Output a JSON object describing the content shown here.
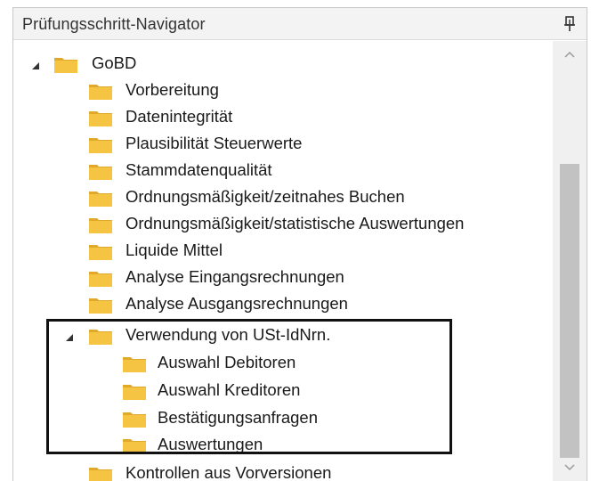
{
  "panel": {
    "title": "Prüfungsschritt-Navigator",
    "pin_icon": "pin-icon"
  },
  "tree": {
    "root": {
      "label": "GoBD",
      "expanded": true
    },
    "items": [
      {
        "label": "Vorbereitung"
      },
      {
        "label": "Datenintegrität"
      },
      {
        "label": "Plausibilität Steuerwerte"
      },
      {
        "label": "Stammdatenqualität"
      },
      {
        "label": "Ordnungsmäßigkeit/zeitnahes Buchen"
      },
      {
        "label": "Ordnungsmäßigkeit/statistische Auswertungen"
      },
      {
        "label": "Liquide Mittel"
      },
      {
        "label": "Analyse Eingangsrechnungen"
      },
      {
        "label": "Analyse Ausgangsrechnungen"
      },
      {
        "label": "Verwendung von USt-IdNrn.",
        "expanded": true,
        "children": [
          {
            "label": "Auswahl Debitoren"
          },
          {
            "label": "Auswahl Kreditoren"
          },
          {
            "label": "Bestätigungsanfragen"
          },
          {
            "label": "Auswertungen"
          }
        ]
      },
      {
        "label": "Kontrollen aus Vorversionen"
      }
    ]
  },
  "colors": {
    "folder": "#f5c443",
    "folder_dark": "#e0a92a",
    "highlight_border": "#111111",
    "scroll_thumb": "#c2c2c2"
  }
}
